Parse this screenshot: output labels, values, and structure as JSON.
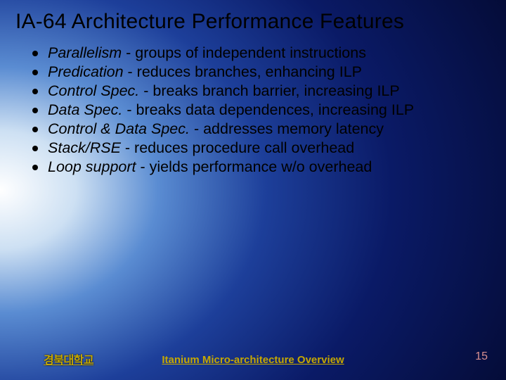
{
  "title": "IA-64 Architecture Performance Features",
  "bullets": [
    {
      "term": "Parallelism",
      "desc": " - groups of independent instructions"
    },
    {
      "term": "Predication",
      "desc": " - reduces branches, enhancing ILP"
    },
    {
      "term": "Control Spec.",
      "desc": " - breaks branch barrier, increasing ILP"
    },
    {
      "term": "Data Spec.",
      "desc": " - breaks data dependences, increasing ILP"
    },
    {
      "term": "Control & Data Spec.",
      "desc": " - addresses memory latency"
    },
    {
      "term": "Stack/RSE",
      "desc": " - reduces procedure call overhead"
    },
    {
      "term": "Loop support",
      "desc": " - yields performance w/o overhead"
    }
  ],
  "footer": {
    "left": "경북대학교",
    "center": "Itanium Micro-architecture Overview",
    "right": "15"
  }
}
